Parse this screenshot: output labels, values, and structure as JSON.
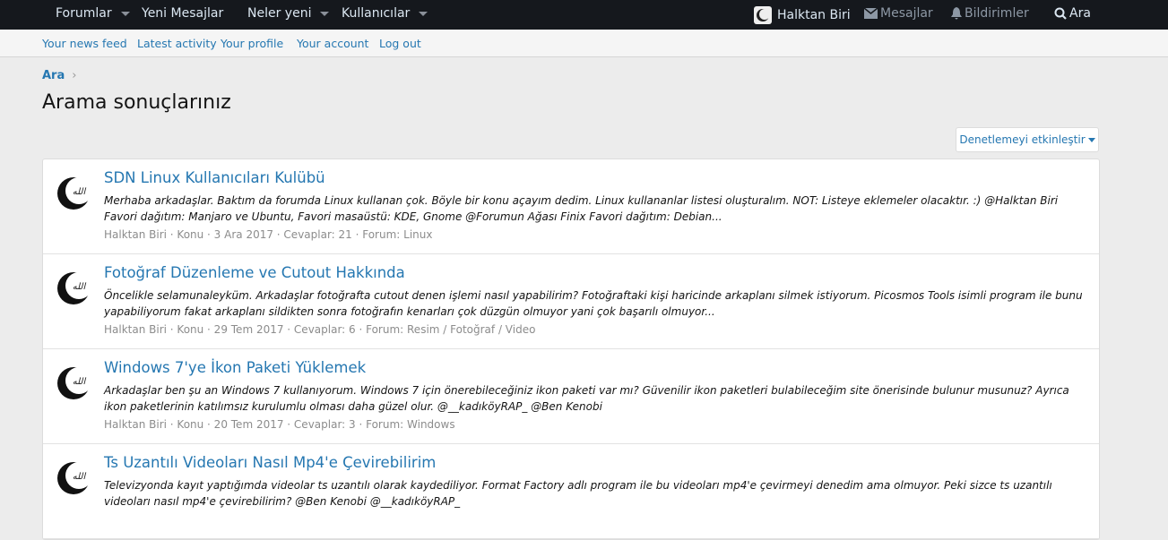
{
  "nav": {
    "items": [
      "Forumlar",
      "Yeni Mesajlar",
      "Neler yeni",
      "Kullanıcılar"
    ],
    "user": "Halktan Biri",
    "messages": "Mesajlar",
    "alerts": "Bildirimler",
    "search": "Ara"
  },
  "subnav": [
    "Your news feed",
    "Latest activity",
    "Your profile",
    "Your account",
    "Log out"
  ],
  "breadcrumb": "Ara",
  "title": "Arama sonuçlarınız",
  "moderation_button": "Denetlemeyi etkinleştir",
  "results": [
    {
      "title": "SDN Linux Kullanıcıları Kulübü",
      "snippet": "Merhaba arkadaşlar. Baktım da forumda Linux kullanan çok. Böyle bir konu açayım dedim. Linux kullananlar listesi oluşturalım. NOT: Listeye eklemeler olacaktır. :) @Halktan Biri Favori dağıtım: Manjaro ve Ubuntu, Favori masaüstü: KDE, Gnome @Forumun Ağası Finix Favori dağıtım: Debian...",
      "meta": "Halktan Biri · Konu · 3 Ara 2017 · Cevaplar: 21 · Forum: Linux"
    },
    {
      "title": "Fotoğraf Düzenleme ve Cutout Hakkında",
      "snippet": "Öncelikle selamunaleyküm. Arkadaşlar fotoğrafta cutout denen işlemi nasıl yapabilirim? Fotoğraftaki kişi haricinde arkaplanı silmek istiyorum. Picosmos Tools isimli program ile bunu yapabiliyorum fakat arkaplanı sildikten sonra fotoğrafın kenarları çok düzgün olmuyor yani çok başarılı olmuyor...",
      "meta": "Halktan Biri · Konu · 29 Tem 2017 · Cevaplar: 6 · Forum: Resim / Fotoğraf / Video"
    },
    {
      "title": "Windows 7'ye İkon Paketi Yüklemek",
      "snippet": "Arkadaşlar ben şu an Windows 7 kullanıyorum. Windows 7 için önerebileceğiniz ikon paketi var mı? Güvenilir ikon paketleri bulabileceğim site önerisinde bulunur musunuz? Ayrıca ikon paketlerinin katılımsız kurulumlu olması daha güzel olur. @__kadıköyRAP_ @Ben Kenobi",
      "meta": "Halktan Biri · Konu · 20 Tem 2017 · Cevaplar: 3 · Forum: Windows"
    },
    {
      "title": "Ts Uzantılı Videoları Nasıl Mp4'e Çevirebilirim",
      "snippet": "Televizyonda kayıt yaptığımda videolar ts uzantılı olarak kaydediliyor. Format Factory adlı program ile bu videoları mp4'e çevirmeyi denedim ama olmuyor. Peki sizce ts uzantılı videoları nasıl mp4'e çevirebilirim? @Ben Kenobi @__kadıköyRAP_",
      "meta": ""
    }
  ]
}
